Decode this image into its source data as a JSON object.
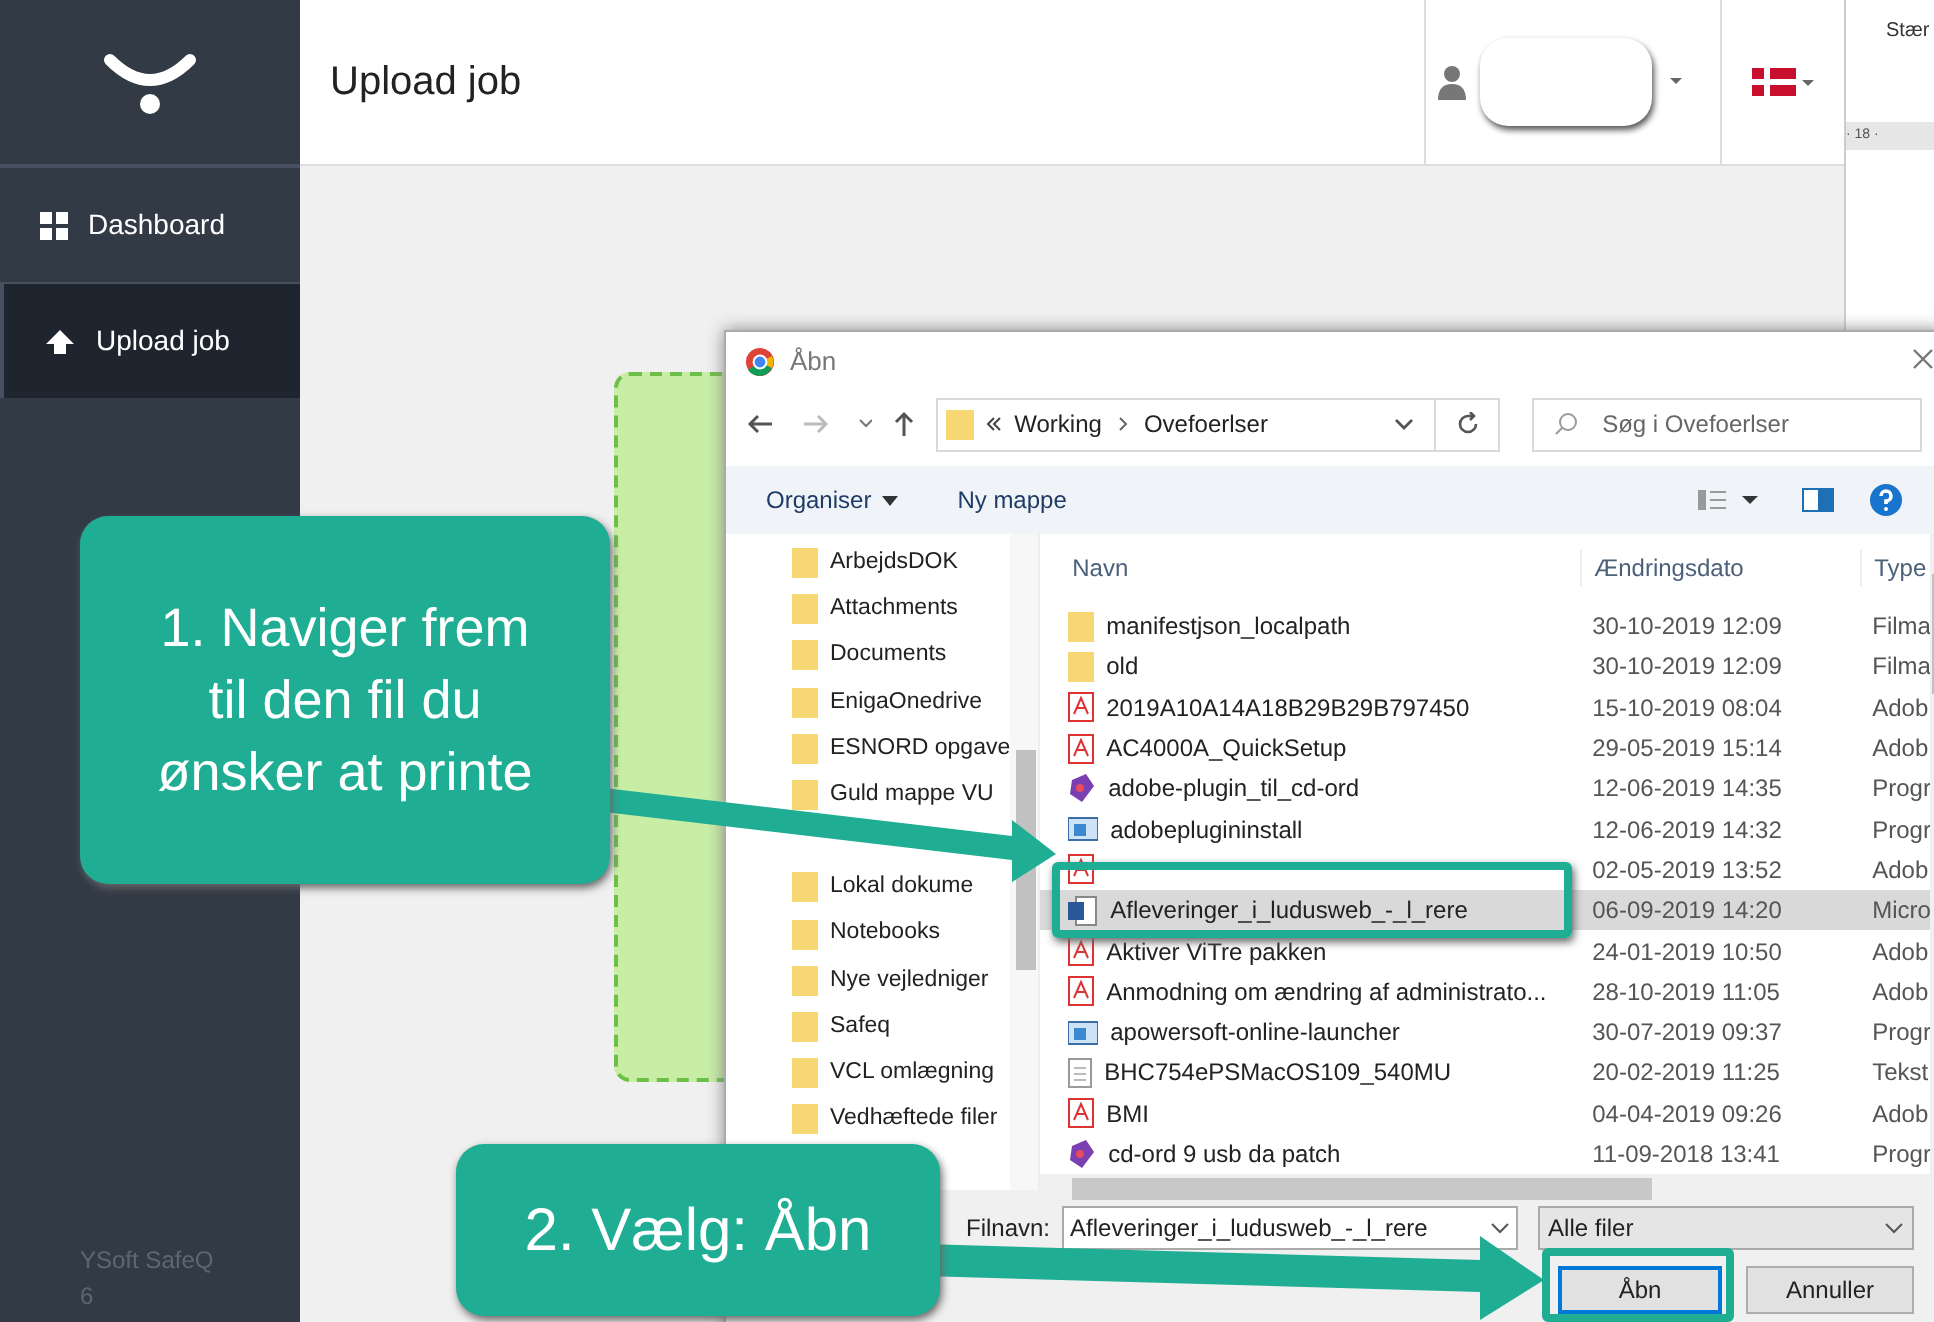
{
  "sidebar": {
    "items": [
      {
        "label": "Dashboard",
        "kind": "grid",
        "selected": false
      },
      {
        "label": "Upload job",
        "kind": "upload",
        "selected": true
      }
    ],
    "footer": "YSoft SafeQ 6"
  },
  "header": {
    "title": "Upload job"
  },
  "word_strip": {
    "label": "Stær",
    "ruler": "· 18 ·"
  },
  "dialog": {
    "title": "Åbn",
    "path": [
      "Working",
      "Ovefoerlser"
    ],
    "search_placeholder": "Søg i Ovefoerlser",
    "organise": "Organiser",
    "new_folder": "Ny mappe",
    "folders": [
      {
        "label": "ArbejdsDOK"
      },
      {
        "label": "Attachments"
      },
      {
        "label": "Documents"
      },
      {
        "label": "EnigaOnedrive"
      },
      {
        "label": "ESNORD opgave"
      },
      {
        "label": "Guld mappe VU"
      },
      {
        "kind": "hidden"
      },
      {
        "label": "Lokal dokume"
      },
      {
        "label": "Notebooks"
      },
      {
        "label": "Nye vejledniger"
      },
      {
        "label": "Safeq"
      },
      {
        "label": "VCL omlægning"
      },
      {
        "label": "Vedhæftede filer"
      }
    ],
    "columns": [
      "Navn",
      "Ændringsdato",
      "Type"
    ],
    "files": [
      {
        "name": "manifestjson_localpath",
        "kind": "folder",
        "date": "30-10-2019 12:09",
        "type": "Filma",
        "selected": false
      },
      {
        "name": "old",
        "kind": "folder",
        "date": "30-10-2019 12:09",
        "type": "Filma",
        "selected": false
      },
      {
        "name": "2019A10A14A18B29B29B797450",
        "kind": "pdf",
        "date": "15-10-2019 08:04",
        "type": "Adob",
        "selected": false
      },
      {
        "name": "AC4000A_QuickSetup",
        "kind": "pdf",
        "date": "29-05-2019 15:14",
        "type": "Adob",
        "selected": false
      },
      {
        "name": "adobe-plugin_til_cd-ord",
        "kind": "plugin",
        "date": "12-06-2019 14:35",
        "type": "Progr",
        "selected": false
      },
      {
        "name": "adobeplugininstall",
        "kind": "installer",
        "date": "12-06-2019 14:32",
        "type": "Progr",
        "selected": false
      },
      {
        "kind": "pdf",
        "date": "02-05-2019 13:52",
        "type": "Adob",
        "selected": false
      },
      {
        "name": "Afleveringer_i_ludusweb_-_l_rere",
        "kind": "word",
        "date": "06-09-2019 14:20",
        "type": "Micro",
        "selected": true
      },
      {
        "name": "Aktiver ViTre pakken",
        "kind": "pdf",
        "date": "24-01-2019 10:50",
        "type": "Adob",
        "selected": false
      },
      {
        "name": "Anmodning om ændring af administrato...",
        "kind": "pdf",
        "date": "28-10-2019 11:05",
        "type": "Adob",
        "selected": false
      },
      {
        "name": "apowersoft-online-launcher",
        "kind": "installer",
        "date": "30-07-2019 09:37",
        "type": "Progr",
        "selected": false
      },
      {
        "name": "BHC754ePSMacOS109_540MU",
        "kind": "text",
        "date": "20-02-2019 11:25",
        "type": "Tekst",
        "selected": false
      },
      {
        "name": "BMI",
        "kind": "pdf",
        "date": "04-04-2019 09:26",
        "type": "Adob",
        "selected": false
      },
      {
        "name": "cd-ord 9 usb da patch",
        "kind": "plugin",
        "date": "11-09-2018 13:41",
        "type": "Progr",
        "selected": false
      }
    ],
    "filename_label": "Filnavn:",
    "filename": "Afleveringer_i_ludusweb_-_l_rere",
    "filter": "Alle filer",
    "open": "Åbn",
    "cancel": "Annuller"
  },
  "callouts": [
    {
      "text": "1. Naviger frem til den fil du ønsker at printe"
    },
    {
      "text": "2. Vælg: Åbn"
    }
  ]
}
